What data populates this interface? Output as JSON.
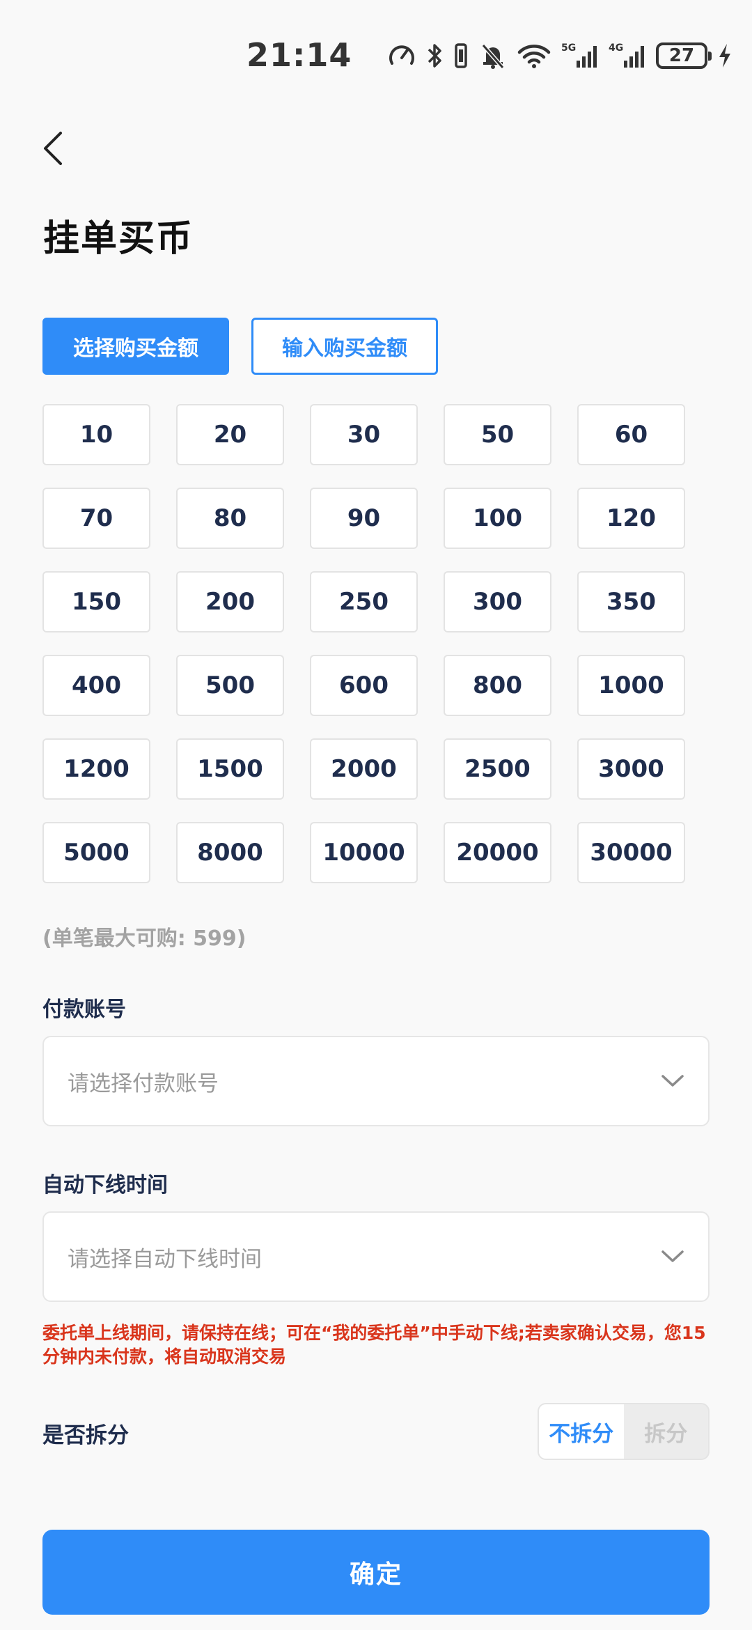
{
  "status_bar": {
    "time": "21:14",
    "battery": "27",
    "network_5g": "5G",
    "network_4g": "4G"
  },
  "page": {
    "title": "挂单买币"
  },
  "mode_tabs": [
    {
      "label": "选择购买金额",
      "active": true
    },
    {
      "label": "输入购买金额",
      "active": false
    }
  ],
  "amounts": [
    "10",
    "20",
    "30",
    "50",
    "60",
    "70",
    "80",
    "90",
    "100",
    "120",
    "150",
    "200",
    "250",
    "300",
    "350",
    "400",
    "500",
    "600",
    "800",
    "1000",
    "1200",
    "1500",
    "2000",
    "2500",
    "3000",
    "5000",
    "8000",
    "10000",
    "20000",
    "30000"
  ],
  "max_hint": "(单笔最大可购: 599)",
  "payment": {
    "label": "付款账号",
    "placeholder": "请选择付款账号"
  },
  "offline": {
    "label": "自动下线时间",
    "placeholder": "请选择自动下线时间"
  },
  "warning": "委托单上线期间，请保持在线；可在“我的委托单”中手动下线;若卖家确认交易，您15分钟内未付款，将自动取消交易",
  "split": {
    "label": "是否拆分",
    "options": [
      "不拆分",
      "拆分"
    ],
    "selected": "不拆分"
  },
  "confirm_label": "确定",
  "colors": {
    "accent": "#2f8cf8",
    "warning": "#d9351c",
    "text": "#1f2d4d"
  }
}
